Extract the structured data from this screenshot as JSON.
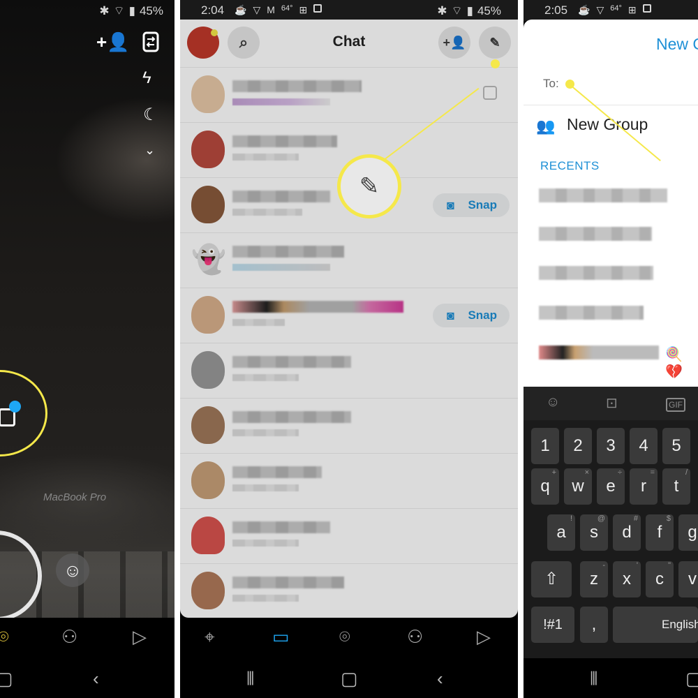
{
  "panel1": {
    "status": {
      "battery": "45%"
    },
    "camera_text": "MacBook Pro"
  },
  "panel2": {
    "status": {
      "time": "2:04",
      "temp": "64°",
      "battery": "45%"
    },
    "title": "Chat",
    "snap_label": "Snap"
  },
  "panel3": {
    "status": {
      "time": "2:05",
      "temp": "64°"
    },
    "title": "New C",
    "to_label": "To:",
    "new_group": "New Group",
    "recents": "RECENTS",
    "keyboard": {
      "numbers": [
        "1",
        "2",
        "3",
        "4",
        "5"
      ],
      "row1": [
        "q",
        "w",
        "e",
        "r",
        "t"
      ],
      "row1_hints": [
        "+",
        "×",
        "÷",
        "=",
        "/"
      ],
      "row2": [
        "a",
        "s",
        "d",
        "f",
        "g"
      ],
      "row2_hints": [
        "!",
        "@",
        "#",
        "$",
        ""
      ],
      "row3": [
        "z",
        "x",
        "c",
        "v"
      ],
      "row3_hints": [
        "-",
        "'",
        "\"",
        ""
      ],
      "symbols_key": "!#1",
      "comma_key": ",",
      "space_label": "English",
      "shift": "⇧",
      "top_gif": "GIF"
    }
  },
  "colors": {
    "callout": "#f5e84a",
    "accent": "#1e90d6"
  }
}
